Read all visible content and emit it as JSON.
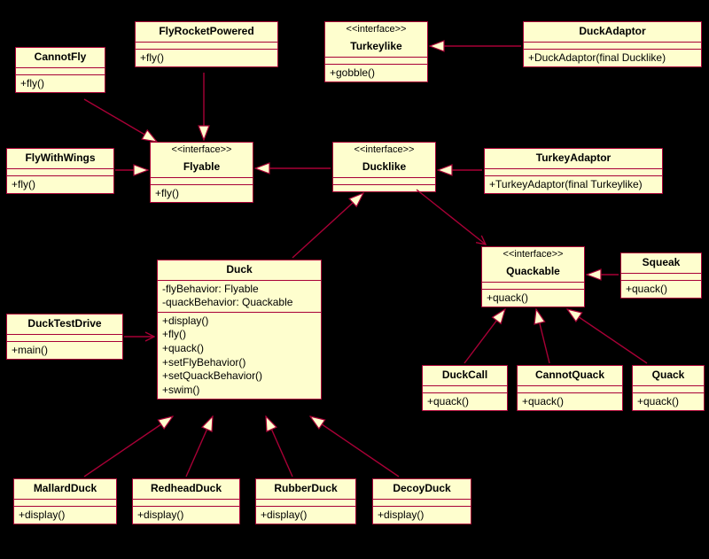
{
  "stereotype": "<<interface>>",
  "classes": {
    "CannotFly": {
      "name": "CannotFly",
      "members": "+fly()"
    },
    "FlyRocket": {
      "name": "FlyRocketPowered",
      "members": "+fly()"
    },
    "Turkeylike": {
      "name": "Turkeylike",
      "members": "+gobble()"
    },
    "DuckAdaptor": {
      "name": "DuckAdaptor",
      "members": "+DuckAdaptor(final Ducklike)"
    },
    "FlyWithWings": {
      "name": "FlyWithWings",
      "members": "+fly()"
    },
    "Flyable": {
      "name": "Flyable",
      "members": "+fly()"
    },
    "Ducklike": {
      "name": "Ducklike",
      "members": ""
    },
    "TurkeyAdaptor": {
      "name": "TurkeyAdaptor",
      "members": "+TurkeyAdaptor(final Turkeylike)"
    },
    "Duck": {
      "name": "Duck",
      "fields": "-flyBehavior: Flyable\n-quackBehavior: Quackable",
      "members": "+display()\n+fly()\n+quack()\n+setFlyBehavior()\n+setQuackBehavior()\n+swim()"
    },
    "DuckTestDrive": {
      "name": "DuckTestDrive",
      "members": "+main()"
    },
    "Quackable": {
      "name": "Quackable",
      "members": "+quack()"
    },
    "Squeak": {
      "name": "Squeak",
      "members": "+quack()"
    },
    "DuckCall": {
      "name": "DuckCall",
      "members": "+quack()"
    },
    "CannotQuack": {
      "name": "CannotQuack",
      "members": "+quack()"
    },
    "Quack": {
      "name": "Quack",
      "members": "+quack()"
    },
    "MallardDuck": {
      "name": "MallardDuck",
      "members": "+display()"
    },
    "RedheadDuck": {
      "name": "RedheadDuck",
      "members": "+display()"
    },
    "RubberDuck": {
      "name": "RubberDuck",
      "members": "+display()"
    },
    "DecoyDuck": {
      "name": "DecoyDuck",
      "members": "+display()"
    }
  },
  "relations_comment": "Generalizations (hollow arrow at target) and directed associations (open arrow).",
  "generalizations": [
    [
      "CannotFly",
      "Flyable"
    ],
    [
      "FlyRocket",
      "Flyable"
    ],
    [
      "FlyWithWings",
      "Flyable"
    ],
    [
      "Ducklike",
      "Flyable"
    ],
    [
      "DuckAdaptor",
      "Turkeylike"
    ],
    [
      "TurkeyAdaptor",
      "Ducklike"
    ],
    [
      "Duck",
      "Ducklike"
    ],
    [
      "Squeak",
      "Quackable"
    ],
    [
      "DuckCall",
      "Quackable"
    ],
    [
      "CannotQuack",
      "Quackable"
    ],
    [
      "Quack",
      "Quackable"
    ],
    [
      "MallardDuck",
      "Duck"
    ],
    [
      "RedheadDuck",
      "Duck"
    ],
    [
      "RubberDuck",
      "Duck"
    ],
    [
      "DecoyDuck",
      "Duck"
    ]
  ],
  "associations": [
    [
      "DuckTestDrive",
      "Duck"
    ],
    [
      "Ducklike",
      "Quackable"
    ]
  ]
}
